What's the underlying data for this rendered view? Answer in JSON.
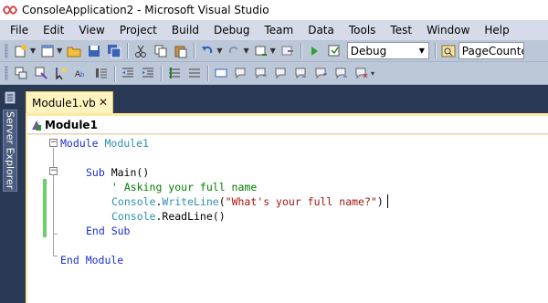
{
  "window": {
    "title": "ConsoleApplication2 - Microsoft Visual Studio"
  },
  "menu": [
    "File",
    "Edit",
    "View",
    "Project",
    "Build",
    "Debug",
    "Team",
    "Data",
    "Tools",
    "Test",
    "Window",
    "Help"
  ],
  "toolbar1": {
    "config_value": "Debug",
    "search_value": "PageCounte"
  },
  "sidebar": {
    "server_explorer_label": "Server Explorer"
  },
  "tabs": [
    {
      "label": "Module1.vb",
      "close": "✕"
    }
  ],
  "navbar": {
    "label": "Module1"
  },
  "code": {
    "line1": {
      "kw": "Module",
      "name": " Module1"
    },
    "line2": {
      "kw": "Sub",
      "name": " Main()"
    },
    "line3": {
      "comment": "' Asking your full name"
    },
    "line4": {
      "type": "Console",
      "dot": ".",
      "method": "WriteLine",
      "open": "(",
      "string": "\"What's your full name?\"",
      "close": ")"
    },
    "line5": {
      "type": "Console",
      "rest": ".ReadLine()"
    },
    "line6": {
      "kw": "End Sub"
    },
    "line7": {
      "kw": "End Module"
    }
  },
  "colors": {
    "keyword": "#1b2ed8",
    "type": "#2b91af",
    "comment": "#008000",
    "string": "#a31515",
    "chrome": "#293955"
  },
  "icons": [
    "vs-logo-icon",
    "new-project-icon",
    "add-item-icon",
    "open-icon",
    "save-icon",
    "save-all-icon",
    "cut-icon",
    "copy-icon",
    "paste-icon",
    "undo-icon",
    "redo-icon",
    "navigate-icon",
    "start-debug-icon",
    "attach-icon",
    "find-icon"
  ]
}
